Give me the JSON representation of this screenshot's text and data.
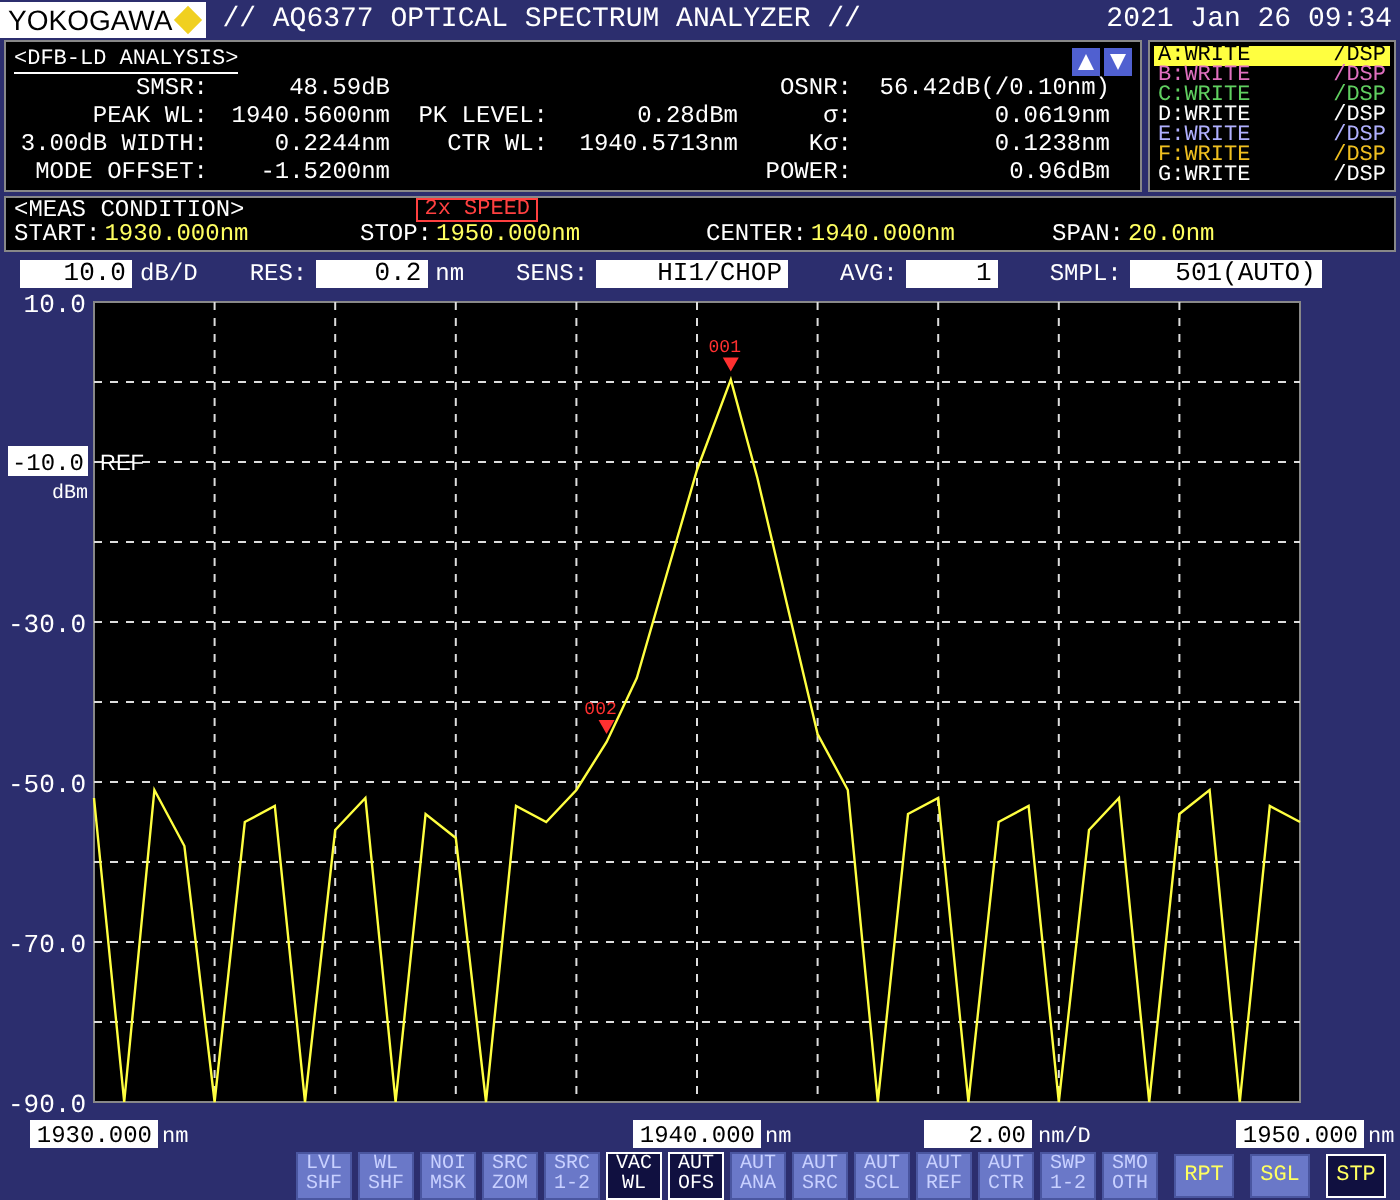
{
  "header": {
    "logo": "YOKOGAWA",
    "title": "// AQ6377 OPTICAL SPECTRUM ANALYZER //",
    "datetime": "2021 Jan 26 09:34"
  },
  "analysis": {
    "title": "<DFB-LD ANALYSIS>",
    "rows": [
      {
        "label": "SMSR:",
        "value": "48.59dB",
        "label3": "OSNR:",
        "value3": "56.42dB(/0.10nm)"
      },
      {
        "label": "PEAK WL:",
        "value": "1940.5600nm",
        "label2": "PK LEVEL:",
        "value2": "0.28dBm",
        "label3": "σ:",
        "value3": "0.0619nm"
      },
      {
        "label": "3.00dB WIDTH:",
        "value": "0.2244nm",
        "label2": "CTR WL:",
        "value2": "1940.5713nm",
        "label3": "Kσ:",
        "value3": "0.1238nm"
      },
      {
        "label": "MODE OFFSET:",
        "value": "-1.5200nm",
        "label3": "POWER:",
        "value3": "0.96dBm"
      }
    ]
  },
  "traces": [
    {
      "label": "A:WRITE",
      "mode": "/DSP",
      "color": "#ffff40",
      "selected": true
    },
    {
      "label": "B:WRITE",
      "mode": "/DSP",
      "color": "#e070c0",
      "selected": false
    },
    {
      "label": "C:WRITE",
      "mode": "/DSP",
      "color": "#60d060",
      "selected": false
    },
    {
      "label": "D:WRITE",
      "mode": "/DSP",
      "color": "#ffffff",
      "selected": false
    },
    {
      "label": "E:WRITE",
      "mode": "/DSP",
      "color": "#b0b0ff",
      "selected": false
    },
    {
      "label": "F:WRITE",
      "mode": "/DSP",
      "color": "#f0c020",
      "selected": false
    },
    {
      "label": "G:WRITE",
      "mode": "/DSP",
      "color": "#ffffff",
      "selected": false
    }
  ],
  "meas_condition": {
    "title": "<MEAS CONDITION>",
    "badge": "2x SPEED",
    "items": [
      {
        "label": "START:",
        "value": "1930.000nm"
      },
      {
        "label": "STOP:",
        "value": "1950.000nm"
      },
      {
        "label": "CENTER:",
        "value": "1940.000nm"
      },
      {
        "label": "SPAN:",
        "value": "20.0nm"
      }
    ]
  },
  "settings": [
    {
      "value": "10.0",
      "unit": "dB/D"
    },
    {
      "label": "RES:",
      "value": "0.2",
      "unit": "nm"
    },
    {
      "label": "SENS:",
      "value": "HI1/CHOP"
    },
    {
      "label": "AVG:",
      "value": "1"
    },
    {
      "label": "SMPL:",
      "value": "501(AUTO)"
    }
  ],
  "ref_level": {
    "value": "-10.0",
    "unit": "dBm",
    "label": "REF"
  },
  "chart_data": {
    "type": "line",
    "grid": true,
    "xlim": [
      1930,
      1950
    ],
    "ylim": [
      -90,
      10
    ],
    "xticks": [
      {
        "value": 1930,
        "label": "1930.000"
      },
      {
        "value": 1940,
        "label": "1940.000"
      },
      {
        "value": 1950,
        "label": "1950.000"
      }
    ],
    "yticks": [
      {
        "value": 10,
        "label": "10.0"
      },
      {
        "value": -30,
        "label": "-30.0"
      },
      {
        "value": -50,
        "label": "-50.0"
      },
      {
        "value": -70,
        "label": "-70.0"
      },
      {
        "value": -90,
        "label": "-90.0"
      }
    ],
    "x": [
      1930,
      1930.5,
      1931,
      1931.5,
      1932,
      1932.5,
      1933,
      1933.5,
      1934,
      1934.5,
      1935,
      1935.5,
      1936,
      1936.5,
      1937,
      1937.5,
      1938,
      1938.5,
      1939,
      1939.5,
      1940,
      1940.56,
      1941,
      1941.5,
      1942,
      1942.5,
      1943,
      1943.5,
      1944,
      1944.5,
      1945,
      1945.5,
      1946,
      1946.5,
      1947,
      1947.5,
      1948,
      1948.5,
      1949,
      1949.5,
      1950
    ],
    "series": [
      {
        "color": "#ffff40",
        "values": [
          -52,
          -90,
          -51,
          -58,
          -90,
          -55,
          -53,
          -90,
          -56,
          -52,
          -90,
          -54,
          -57,
          -90,
          -53,
          -55,
          -51,
          -45,
          -37,
          -24,
          -11,
          0.3,
          -12,
          -28,
          -44,
          -51,
          -90,
          -54,
          -52,
          -90,
          -55,
          -53,
          -90,
          -56,
          -52,
          -90,
          -54,
          -51,
          -90,
          -53,
          -55
        ]
      }
    ],
    "annotations": [
      {
        "text": "001",
        "x": 1940.56,
        "y": 0.3
      },
      {
        "text": "002",
        "x": 1938.5,
        "y": -45
      }
    ]
  },
  "x_units": [
    "nm",
    "nm",
    "nm"
  ],
  "division": {
    "value": "2.00",
    "unit": "nm/D"
  },
  "soft_keys": [
    {
      "lines": [
        "LVL",
        "SHF"
      ],
      "active": false
    },
    {
      "lines": [
        "WL",
        "SHF"
      ],
      "active": false
    },
    {
      "lines": [
        "NOI",
        "MSK"
      ],
      "active": false
    },
    {
      "lines": [
        "SRC",
        "ZOM"
      ],
      "active": false
    },
    {
      "lines": [
        "SRC",
        "1-2"
      ],
      "active": false
    },
    {
      "lines": [
        "VAC",
        "WL"
      ],
      "active": true
    },
    {
      "lines": [
        "AUT",
        "OFS"
      ],
      "active": true
    },
    {
      "lines": [
        "AUT",
        "ANA"
      ],
      "active": false
    },
    {
      "lines": [
        "AUT",
        "SRC"
      ],
      "active": false
    },
    {
      "lines": [
        "AUT",
        "SCL"
      ],
      "active": false
    },
    {
      "lines": [
        "AUT",
        "REF"
      ],
      "active": false
    },
    {
      "lines": [
        "AUT",
        "CTR"
      ],
      "active": false
    },
    {
      "lines": [
        "SWP",
        "1-2"
      ],
      "active": false
    },
    {
      "lines": [
        "SMO",
        "OTH"
      ],
      "active": false
    }
  ],
  "sweep_keys": [
    {
      "label": "RPT",
      "selected": false
    },
    {
      "label": "SGL",
      "selected": false
    },
    {
      "label": "STP",
      "selected": true
    }
  ]
}
